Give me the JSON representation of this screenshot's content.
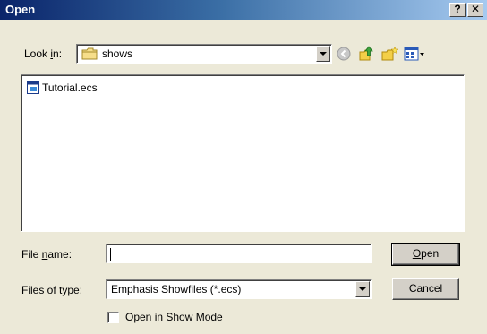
{
  "window": {
    "title": "Open",
    "help_label": "?",
    "close_label": "✕"
  },
  "look_in": {
    "label_prefix": "Look ",
    "label_accel": "i",
    "label_suffix": "n:",
    "value": "shows"
  },
  "toolbar": {
    "icons": [
      "back-icon",
      "up-folder-icon",
      "new-folder-icon",
      "view-menu-icon"
    ]
  },
  "files": [
    {
      "name": "Tutorial.ecs",
      "icon": "showfile-icon"
    }
  ],
  "file_name": {
    "label_prefix": "File ",
    "label_accel": "n",
    "label_suffix": "ame:",
    "value": ""
  },
  "file_type": {
    "label_prefix": "Files of ",
    "label_accel": "t",
    "label_suffix": "ype:",
    "value": "Emphasis Showfiles (*.ecs)"
  },
  "buttons": {
    "open_accel": "O",
    "open_rest": "pen",
    "cancel": "Cancel"
  },
  "show_mode": {
    "label": "Open in Show Mode",
    "checked": false
  },
  "colors": {
    "title_start": "#0a246a",
    "title_end": "#a6caf0",
    "face": "#ece9d8"
  }
}
